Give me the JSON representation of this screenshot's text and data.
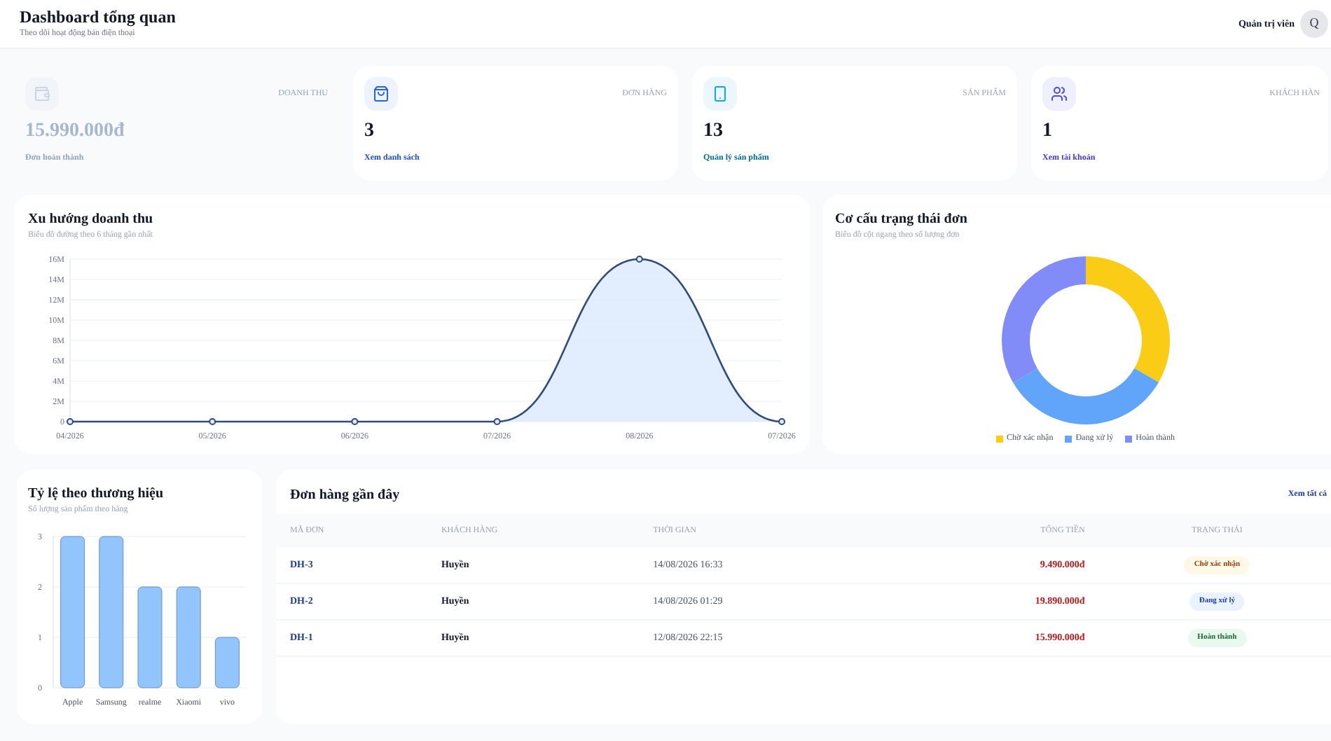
{
  "header": {
    "title": "Dashboard tổng quan",
    "subtitle": "Theo dõi hoạt động bán điện thoại",
    "user": {
      "name": "Quản trị viên",
      "avatar": "Q"
    }
  },
  "stats": [
    {
      "kind": "revenue",
      "label": "DOANH THU",
      "value": "15.990.000đ",
      "link": "Đơn hoàn thành"
    },
    {
      "kind": "orders",
      "label": "ĐƠN HÀNG",
      "value": "3",
      "link": "Xem danh sách"
    },
    {
      "kind": "products",
      "label": "SẢN PHẨM",
      "value": "13",
      "link": "Quản lý sản phẩm"
    },
    {
      "kind": "customers",
      "label": "KHÁCH HÀN",
      "value": "1",
      "link": "Xem tài khoản"
    }
  ],
  "revenue_chart": {
    "title": "Xu hướng doanh thu",
    "subtitle": "Biểu đồ đường theo 6 tháng gần nhất",
    "chart_data": {
      "type": "area",
      "categories": [
        "04/2026",
        "05/2026",
        "06/2026",
        "07/2026",
        "08/2026",
        "07/2026"
      ],
      "series": [
        {
          "color": "#2f4a7f",
          "values": [
            0,
            0,
            0,
            0,
            16000000,
            0
          ]
        }
      ],
      "grid": true,
      "ylim": [
        0,
        16000000
      ],
      "yticks": [
        {
          "value": 0,
          "label": "0"
        },
        {
          "value": 2000000,
          "label": "2M"
        },
        {
          "value": 4000000,
          "label": "4M"
        },
        {
          "value": 6000000,
          "label": "6M"
        },
        {
          "value": 8000000,
          "label": "8M"
        },
        {
          "value": 10000000,
          "label": "10M"
        },
        {
          "value": 12000000,
          "label": "12M"
        },
        {
          "value": 14000000,
          "label": "14M"
        },
        {
          "value": 16000000,
          "label": "16M"
        }
      ]
    }
  },
  "status_chart": {
    "title": "Cơ cấu trạng thái đơn",
    "subtitle": "Biểu đồ cột ngang theo số lượng đơn",
    "chart_data": {
      "type": "donut",
      "categories": [
        "Chờ xác nhận",
        "Đang xử lý",
        "Hoàn thành"
      ],
      "values": [
        33.3,
        33.3,
        33.4
      ],
      "colors": [
        "#facc15",
        "#60a5fa",
        "#818cf8"
      ]
    }
  },
  "brand_chart": {
    "title": "Tỷ lệ theo thương hiệu",
    "subtitle": "Số lượng sản phẩm theo hãng",
    "chart_data": {
      "type": "bar",
      "categories": [
        "Apple",
        "Samsung",
        "realme",
        "Xiaomi",
        "vivo"
      ],
      "series": [
        {
          "color": "#93c5fd",
          "values": [
            3,
            3,
            2,
            2,
            1
          ]
        }
      ],
      "ylim": [
        0,
        3
      ],
      "yticks": [
        0,
        1,
        2,
        3
      ],
      "grid": true
    }
  },
  "orders": {
    "title": "Đơn hàng gần đây",
    "link": "Xem tất cả",
    "columns": [
      "MÃ ĐƠN",
      "KHÁCH HÀNG",
      "THỜI GIAN",
      "TỔNG TIỀN",
      "TRẠNG THÁI"
    ],
    "rows": [
      {
        "id": "DH-3",
        "customer": "Huyền",
        "time": "14/08/2026 16:33",
        "total": "9.490.000đ",
        "status": {
          "kind": "pending",
          "label": "Chờ xác nhận"
        }
      },
      {
        "id": "DH-2",
        "customer": "Huyền",
        "time": "14/08/2026 01:29",
        "total": "19.890.000đ",
        "status": {
          "kind": "processing",
          "label": "Đang xử lý"
        }
      },
      {
        "id": "DH-1",
        "customer": "Huyền",
        "time": "12/08/2026 22:15",
        "total": "15.990.000đ",
        "status": {
          "kind": "done",
          "label": "Hoàn thành"
        }
      }
    ]
  }
}
